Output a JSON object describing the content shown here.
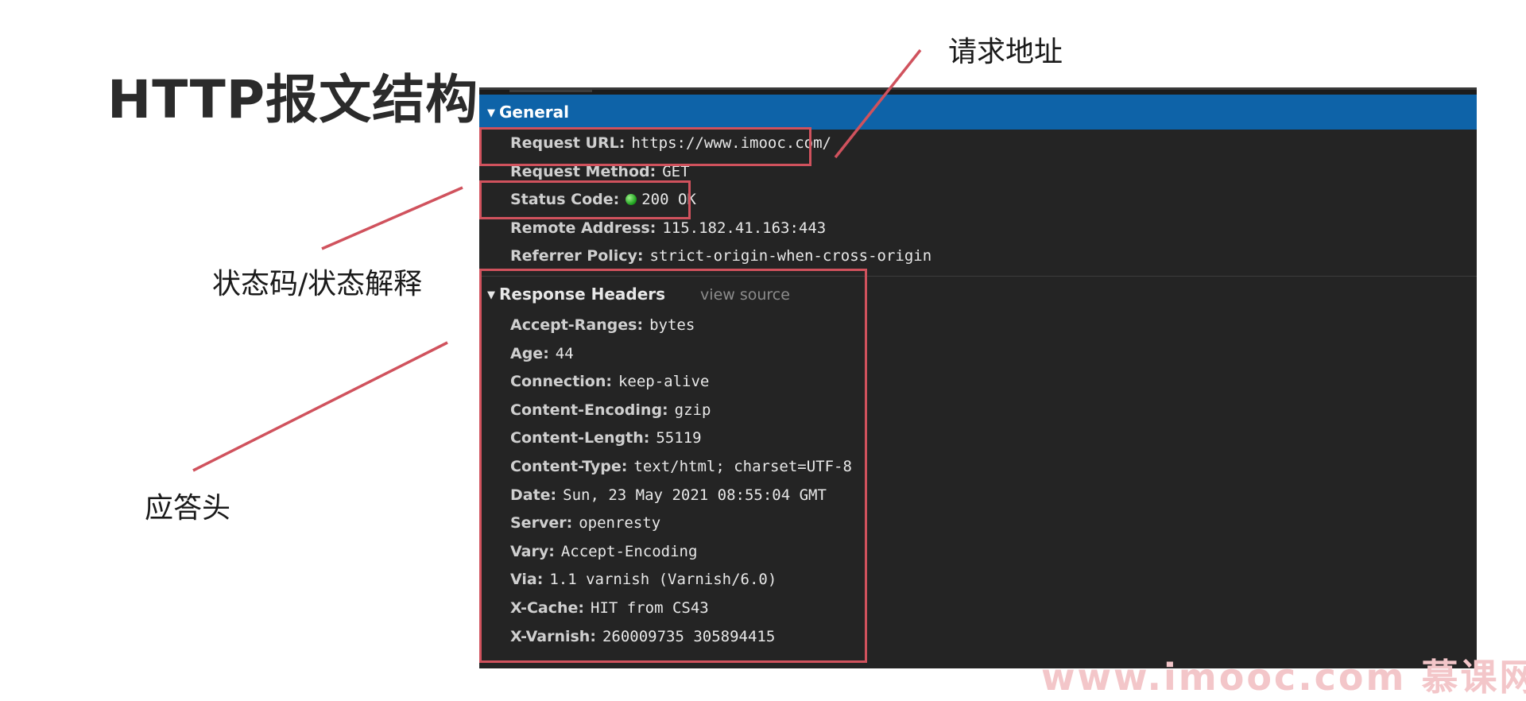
{
  "slide": {
    "title": "HTTP报文结构",
    "annotations": {
      "request_url": "请求地址",
      "status": "状态码/状态解释",
      "response_headers": "应答头"
    },
    "highlight_color": "#d0525d",
    "watermark": "www.imooc.com  慕课网"
  },
  "devtools": {
    "general": {
      "title": "General",
      "rows": [
        {
          "name": "Request URL:",
          "value": "https://www.imooc.com/"
        },
        {
          "name": "Request Method:",
          "value": "GET"
        },
        {
          "name": "Status Code:",
          "value": "200 OK"
        },
        {
          "name": "Remote Address:",
          "value": "115.182.41.163:443"
        },
        {
          "name": "Referrer Policy:",
          "value": "strict-origin-when-cross-origin"
        }
      ]
    },
    "response_headers": {
      "title": "Response Headers",
      "view_source": "view source",
      "rows": [
        {
          "name": "Accept-Ranges:",
          "value": "bytes"
        },
        {
          "name": "Age:",
          "value": "44"
        },
        {
          "name": "Connection:",
          "value": "keep-alive"
        },
        {
          "name": "Content-Encoding:",
          "value": "gzip"
        },
        {
          "name": "Content-Length:",
          "value": "55119"
        },
        {
          "name": "Content-Type:",
          "value": "text/html; charset=UTF-8"
        },
        {
          "name": "Date:",
          "value": "Sun, 23 May 2021 08:55:04 GMT"
        },
        {
          "name": "Server:",
          "value": "openresty"
        },
        {
          "name": "Vary:",
          "value": "Accept-Encoding"
        },
        {
          "name": "Via:",
          "value": "1.1 varnish (Varnish/6.0)"
        },
        {
          "name": "X-Cache:",
          "value": "HIT from CS43"
        },
        {
          "name": "X-Varnish:",
          "value": "260009735 305894415"
        }
      ]
    },
    "colors": {
      "panel_bg": "#242424",
      "general_header_bg": "#0e63a8",
      "status_dot": "#1fa21f"
    }
  }
}
